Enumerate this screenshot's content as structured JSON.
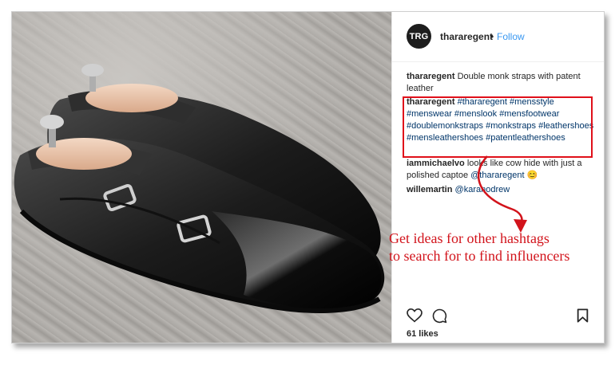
{
  "post": {
    "avatar_text": "TRG",
    "username": "thararegent",
    "dot": "•",
    "follow_label": "Follow"
  },
  "caption": {
    "user": "thararegent",
    "text": "Double monk straps with patent leather"
  },
  "hashtag_comment": {
    "user": "thararegent",
    "tags": [
      "#thararegent",
      "#mensstyle",
      "#menswear",
      "#menslook",
      "#mensfootwear",
      "#doublemonkstraps",
      "#monkstraps",
      "#leathershoes",
      "#mensleathershoes",
      "#patentleathershoes"
    ]
  },
  "comments": [
    {
      "user": "iammichaelvo",
      "text": "looks like cow hide with just a polished captoe",
      "mention": "@thararegent",
      "emoji": "😊"
    },
    {
      "user": "willemartin",
      "mention": "@karanodrew"
    }
  ],
  "likes_text": "61 likes",
  "annotation": {
    "line1": "Get ideas for other hashtags",
    "line2": "to search for to find influencers"
  },
  "colors": {
    "accent": "#3897f0",
    "highlight": "#e0101a",
    "annotation": "#d2131b",
    "tag": "#003569"
  },
  "icons": [
    "heart-icon",
    "comment-icon",
    "bookmark-icon"
  ]
}
